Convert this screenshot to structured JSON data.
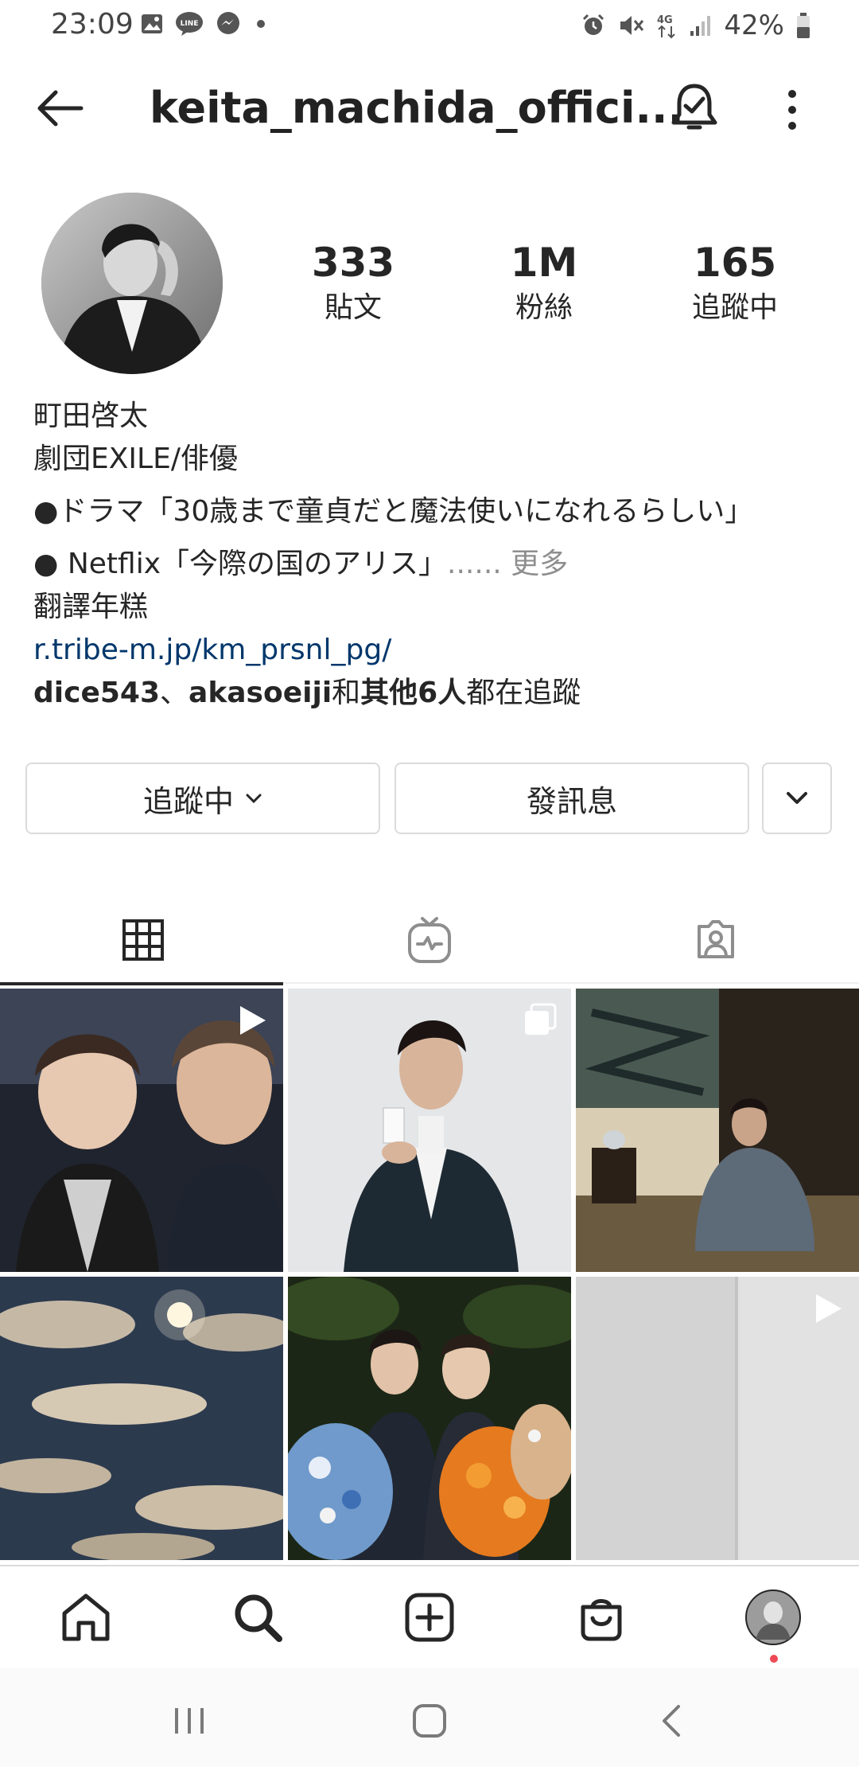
{
  "status_bar": {
    "time": "23:09",
    "battery": "42%",
    "network": "4G",
    "left_icons": [
      "image-icon",
      "line-icon",
      "messenger-icon",
      "dot-icon"
    ],
    "right_icons": [
      "alarm-icon",
      "mute-icon",
      "network-4g-icon",
      "signal-icon",
      "battery-icon"
    ]
  },
  "header": {
    "username": "keita_machida_offici...",
    "icons": [
      "back-arrow-icon",
      "bell-check-icon",
      "more-vertical-icon"
    ]
  },
  "profile": {
    "stats": [
      {
        "value": "333",
        "label": "貼文"
      },
      {
        "value": "1M",
        "label": "粉絲"
      },
      {
        "value": "165",
        "label": "追蹤中"
      }
    ],
    "name": "町田啓太",
    "category": "劇団EXILE/俳優",
    "bio_line1": "●ドラマ「30歳まで童貞だと魔法使いになれるらしい」",
    "bio_line2": "● Netflix「今際の国のアリス」",
    "bio_more_ellipsis": "......",
    "bio_more": "更多",
    "translate": "翻譯年糕",
    "link": "r.tribe-m.jp/km_prsnl_pg/",
    "followed_by_user1": "dice543",
    "followed_by_sep": "、",
    "followed_by_user2": "akasoeiji",
    "followed_by_and": "和",
    "followed_by_others": "其他6人",
    "followed_by_suffix": "都在追蹤"
  },
  "buttons": {
    "following": "追蹤中",
    "message": "發訊息"
  },
  "tabs": [
    {
      "icon": "grid-icon",
      "active": true
    },
    {
      "icon": "igtv-icon",
      "active": false
    },
    {
      "icon": "tagged-icon",
      "active": false
    }
  ],
  "posts": [
    {
      "desc": "two men selfie",
      "badge": "play-icon"
    },
    {
      "desc": "man in suit with bottle",
      "badge": "multi-icon"
    },
    {
      "desc": "man in kimono",
      "badge": ""
    },
    {
      "desc": "moon in clouds",
      "badge": ""
    },
    {
      "desc": "two men with bouquets",
      "badge": ""
    },
    {
      "desc": "plain wall",
      "badge": "play-icon"
    }
  ],
  "bottom_nav": [
    "home-icon",
    "search-icon",
    "new-post-icon",
    "shop-icon",
    "profile-avatar"
  ],
  "system_nav": [
    "recents-icon",
    "home-circle-icon",
    "back-chevron-icon"
  ],
  "colors": {
    "text": "#262626",
    "link": "#00376b",
    "muted": "#8e8e8e",
    "border": "#dbdbdb",
    "notification_dot": "#ed4956"
  }
}
